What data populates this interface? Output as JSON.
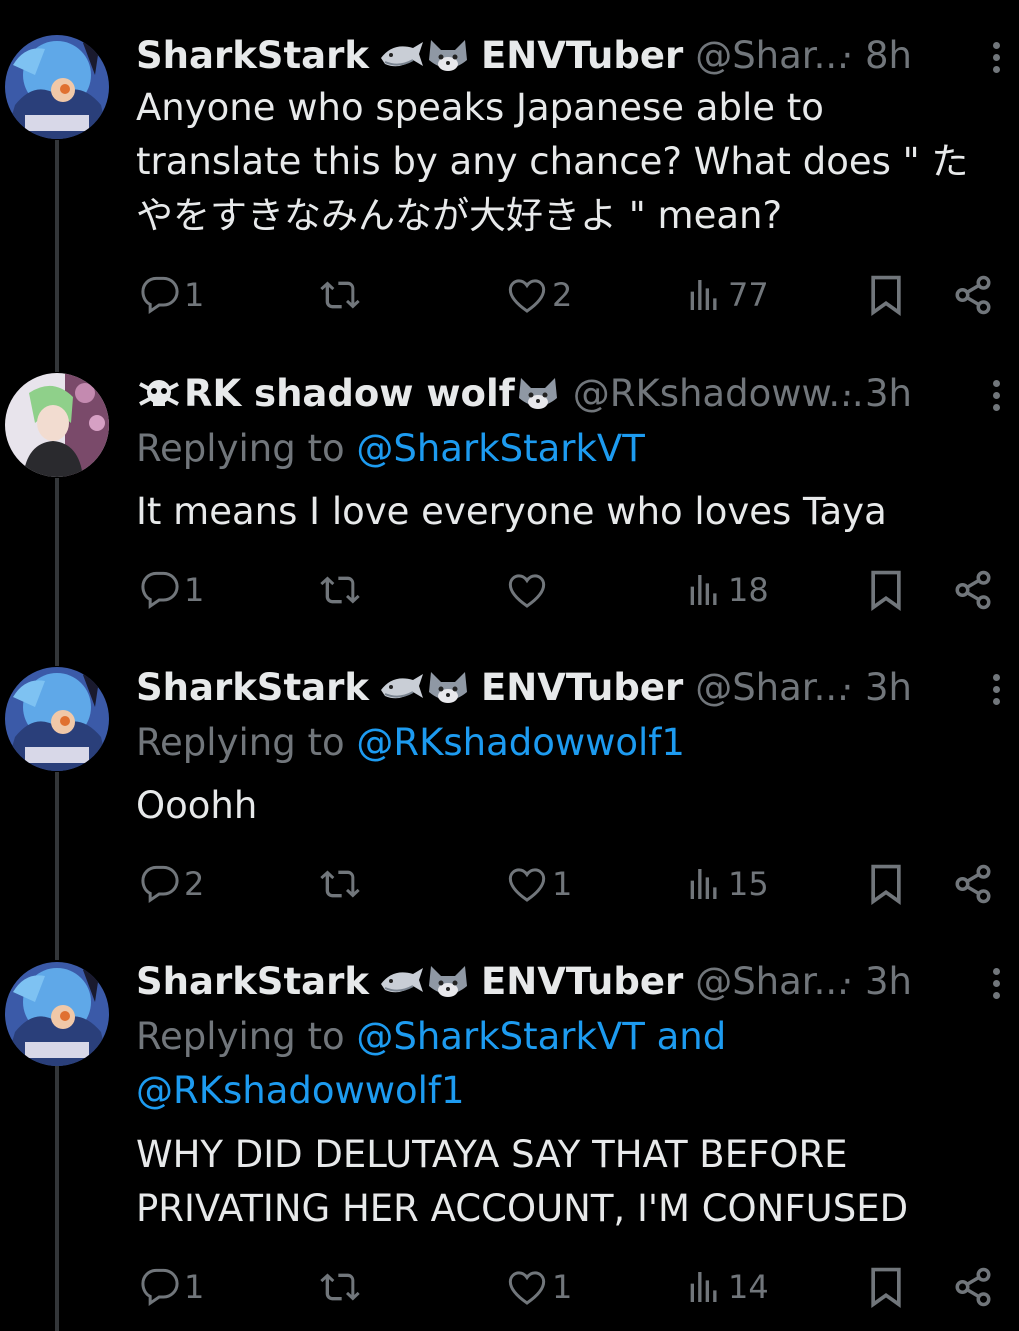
{
  "tweets": [
    {
      "name": "SharkStark",
      "name_suffix": "ENVTuber",
      "handle": "@Shar...",
      "time": "· 8h",
      "replying_prefix": "",
      "replying_links": [],
      "text_lines": [
        "Anyone who speaks Japanese able to",
        "translate this by any chance? What does \" た",
        "やをすきなみんなが大好きよ \" mean?"
      ],
      "replies": "1",
      "reposts": "",
      "likes": "2",
      "views": "77"
    },
    {
      "name": "RK shadow wolf",
      "name_suffix": "",
      "handle": "@RKshadoww...",
      "time": "· 3h",
      "replying_prefix": "Replying to",
      "replying_links": [
        "@SharkStarkVT"
      ],
      "text_lines": [
        "It means I love everyone who loves Taya"
      ],
      "replies": "1",
      "reposts": "",
      "likes": "",
      "views": "18"
    },
    {
      "name": "SharkStark",
      "name_suffix": "ENVTuber",
      "handle": "@Shar...",
      "time": "· 3h",
      "replying_prefix": "Replying to",
      "replying_links": [
        "@RKshadowwolf1"
      ],
      "text_lines": [
        "Ooohh"
      ],
      "replies": "2",
      "reposts": "",
      "likes": "1",
      "views": "15"
    },
    {
      "name": "SharkStark",
      "name_suffix": "ENVTuber",
      "handle": "@Shar...",
      "time": "· 3h",
      "replying_prefix": "Replying to",
      "replying_line1_link": "@SharkStarkVT and",
      "replying_line2_link": "@RKshadowwolf1",
      "text_lines": [
        "WHY DID DELUTAYA SAY THAT BEFORE",
        "PRIVATING HER ACCOUNT, I'M CONFUSED"
      ],
      "replies": "1",
      "reposts": "",
      "likes": "1",
      "views": "14"
    }
  ],
  "colors": {
    "background": "#000000",
    "text": "#e7e9ea",
    "secondary": "#71767b",
    "link": "#1d9bf0",
    "thread_line": "#333639"
  },
  "icons": {
    "reply": "speech-bubble-icon",
    "repost": "repost-arrows-icon",
    "like": "heart-icon",
    "views": "bar-chart-icon",
    "bookmark": "bookmark-icon",
    "share": "share-icon",
    "more": "more-dots-icon"
  }
}
